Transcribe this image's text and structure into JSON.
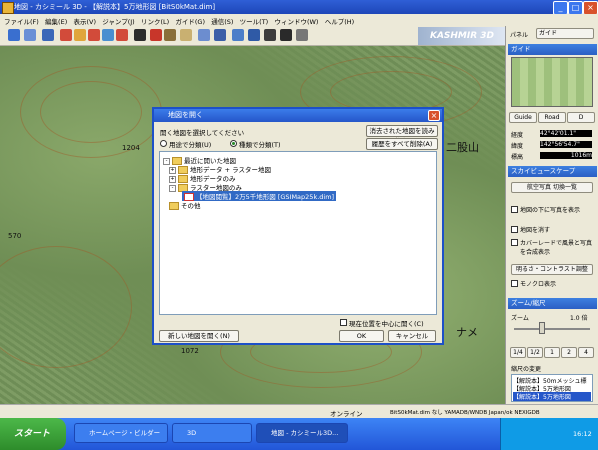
{
  "window": {
    "title": "地図 - カシミール 3D - 【解説本】5万地形図 [BitS0kMat.dim]"
  },
  "menu": [
    "ファイル(F)",
    "編集(E)",
    "表示(V)",
    "ジャンプ(J)",
    "リンク(L)",
    "ガイド(G)",
    "通信(S)",
    "ツール(T)",
    "ウィンドウ(W)",
    "ヘルプ(H)"
  ],
  "brand": "KASHMIR 3D",
  "map_labels": [
    "1204",
    "1072",
    "570",
    "二股山",
    "ナメ"
  ],
  "panel": {
    "select_label": "パネル",
    "select_value": "ガイド",
    "guide_title": "ガイド",
    "nav_buttons": [
      "Guide",
      "Road",
      "D"
    ],
    "lat_label": "経度",
    "lat_value": "42°42'01.1\"",
    "lon_label": "緯度",
    "lon_value": "142°56'54.7\"",
    "alt_label": "標高",
    "alt_value": "1016m",
    "sky_title": "スカイビュースケープ",
    "aerial_btn": "航空写真 切換一覧",
    "checks": [
      "地図の下に写真を表示",
      "地図を消す",
      "カバーレードで風景と写真を合成表示"
    ],
    "brightness_btn": "明るさ・コントラスト調整",
    "mono_label": "モノクロ表示",
    "zoom_title": "ズーム/縮尺",
    "zoom_label": "ズーム",
    "zoom_value": "1.0 倍",
    "zoom_btns": [
      "1/4",
      "1/2",
      "1",
      "2",
      "4"
    ],
    "scale_label": "縮尺の変更",
    "scale_items": [
      "【解説本】50mメッシュ標",
      "【解説本】5万地形図",
      "【解説本】5万地形図"
    ]
  },
  "dialog": {
    "title": "地図を開く",
    "prompt": "開く地図を選択してください",
    "btn_find": "消去された地図を読み込む",
    "btn_clear": "履歴をすべて削除(A)",
    "radio1": "用途で分類(U)",
    "radio2": "種類で分類(T)",
    "tree": [
      {
        "label": "最近に開いた地図",
        "level": 0,
        "expander": "-"
      },
      {
        "label": "地形データ + ラスター地図",
        "level": 1,
        "expander": "+"
      },
      {
        "label": "地形データのみ",
        "level": 1,
        "expander": "+"
      },
      {
        "label": "ラスター地図のみ",
        "level": 1,
        "expander": "-"
      },
      {
        "label": "【地図閲覧】2万5千地形図 [GSIMap25k.dim]",
        "level": 2,
        "expander": ""
      },
      {
        "label": "その他",
        "level": 1,
        "expander": ""
      }
    ],
    "center_check": "現在位置を中心に開く(C)",
    "btn_new": "新しい地図を開く(N)",
    "btn_ok": "OK",
    "btn_cancel": "キャンセル"
  },
  "status": {
    "left": "オンライン",
    "right": "BitS0kMat.dim  なし  YAMADB/WNDB  Japan/ok  NEXIGDB"
  },
  "taskbar": {
    "start": "スタート",
    "tasks": [
      "ホームページ・ビルダー",
      "3D",
      "地図 - カシミール3D..."
    ],
    "time": "16:12"
  },
  "colors": {
    "accent": "#2556c9",
    "panel_bg": "#ece9d8",
    "taskbar": "#2256d8"
  }
}
